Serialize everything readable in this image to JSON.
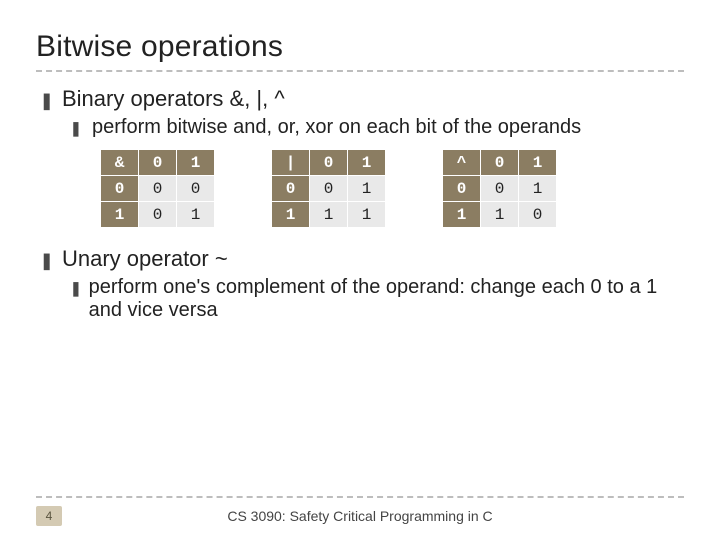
{
  "title": "Bitwise operations",
  "bullet1": {
    "text": "Binary operators &, |, ^",
    "sub": "perform bitwise and, or, xor on each bit of the operands"
  },
  "bullet2": {
    "text": "Unary operator ~",
    "sub": "perform one's complement of the operand: change each 0 to a 1 and vice versa"
  },
  "chart_data": [
    {
      "type": "table",
      "title": "&",
      "categories": [
        "0",
        "1"
      ],
      "rows": [
        "0",
        "1"
      ],
      "values": [
        [
          "0",
          "0"
        ],
        [
          "0",
          "1"
        ]
      ]
    },
    {
      "type": "table",
      "title": "|",
      "categories": [
        "0",
        "1"
      ],
      "rows": [
        "0",
        "1"
      ],
      "values": [
        [
          "0",
          "1"
        ],
        [
          "1",
          "1"
        ]
      ]
    },
    {
      "type": "table",
      "title": "^",
      "categories": [
        "0",
        "1"
      ],
      "rows": [
        "0",
        "1"
      ],
      "values": [
        [
          "0",
          "1"
        ],
        [
          "1",
          "0"
        ]
      ]
    }
  ],
  "footer": {
    "page": "4",
    "course": "CS 3090: Safety Critical Programming in C"
  }
}
